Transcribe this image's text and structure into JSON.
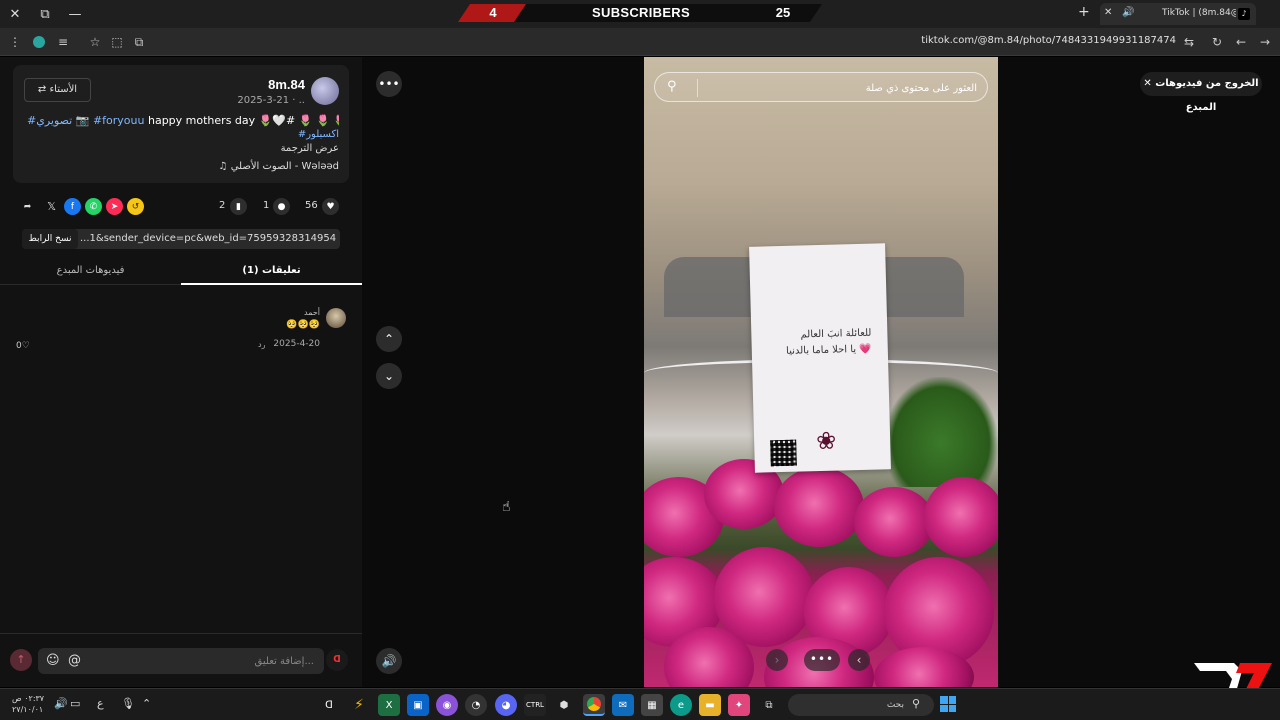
{
  "browser": {
    "subscriber_counter": {
      "left": "4",
      "label": "SUBSCRIBERS",
      "right": "25"
    },
    "tab_title": "TikTok | (8m.84@) ..",
    "url": "tiktok.com/@8m.84/photo/7484331949931187474"
  },
  "post": {
    "username": "8m.84",
    "date": "2025-3-21 · ..",
    "follow_label": "الأستاء",
    "caption_text": "happy mothers day 🌷🤍# 🌷 🌷 🌷 🌷 🌷",
    "caption_tag1": "#foryouu",
    "caption_tag2": "#تصويري 📷",
    "caption_line2": "#اكسبلور",
    "translate_label": "عرض الترجمة",
    "sound": "♫ الصوت الأصلي - Wələəd"
  },
  "actions": {
    "likes": "56",
    "comments": "1",
    "saves": "2"
  },
  "share": {
    "link": "...1&sender_device=pc&web_id=7595932831495489025",
    "copy_label": "نسخ الرابط"
  },
  "tabs": {
    "comments_label": "تعليقات (1)",
    "creator_videos_label": "فيديوهات المبدع"
  },
  "comment": {
    "author": "أحمد",
    "text": "🥺🥺🥺",
    "date": "2025-4-20",
    "reply_label": "رد",
    "likes": "0♡"
  },
  "comment_bar": {
    "placeholder": "إضافة تعليق..."
  },
  "viewer": {
    "exit_label": "الخروج من فيديوهات المبدع",
    "search_placeholder": "العثور على محتوى ذي صلة",
    "card_line1": "للعائلة انبَ العالم",
    "card_line2": "يا احلا ماما بالدنيا 💗"
  },
  "taskbar": {
    "time": "٠٢:٣٧ ص",
    "date": "٢٧/١٠/٠١",
    "search_placeholder": "بحث",
    "lang": "ع"
  },
  "colors": {
    "accent_red": "#b01818",
    "link_blue": "#7fb7ff",
    "rose_pink": "#d02880"
  }
}
